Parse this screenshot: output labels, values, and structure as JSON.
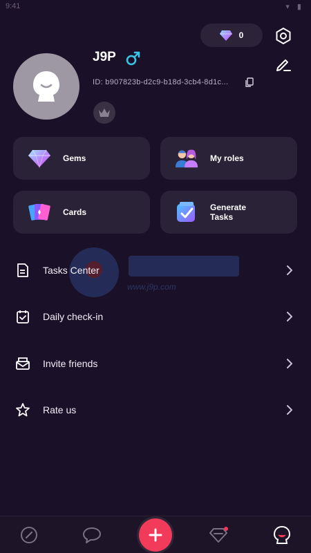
{
  "status_bar": {
    "time": "9:41",
    "icons": "▾ ▮"
  },
  "header": {
    "gem_balance": "0",
    "icons": {
      "gem": "gem-icon",
      "settings": "hexagon-settings-icon",
      "edit": "pencil-edit-icon"
    }
  },
  "profile": {
    "username": "J9P",
    "gender": "male",
    "user_id": "ID: b907823b-d2c9-b18d-3cb4-8d1c...",
    "avatar": "ghost-avatar",
    "badge": "crown-badge"
  },
  "cards": [
    {
      "label": "Gems",
      "icon": "gem-icon"
    },
    {
      "label": "My roles",
      "icon": "roles-icon"
    },
    {
      "label": "Cards",
      "icon": "cards-icon"
    },
    {
      "label": "Generate Tasks",
      "icon": "generate-tasks-icon"
    }
  ],
  "menu": [
    {
      "label": "Tasks Center",
      "icon": "tasks-icon"
    },
    {
      "label": "Daily check-in",
      "icon": "calendar-check-icon"
    },
    {
      "label": "Invite friends",
      "icon": "invite-mail-icon"
    },
    {
      "label": "Rate us",
      "icon": "star-icon"
    }
  ],
  "watermark": {
    "text": "www.j9p.com"
  },
  "bottom_nav": [
    {
      "name": "discover",
      "icon": "compass-icon"
    },
    {
      "name": "chat",
      "icon": "chat-bubble-icon"
    },
    {
      "name": "create",
      "icon": "plus-icon"
    },
    {
      "name": "gems",
      "icon": "gem-outline-icon",
      "badge": true
    },
    {
      "name": "profile",
      "icon": "ghost-avatar-icon",
      "active": true
    }
  ],
  "colors": {
    "background": "#1a1028",
    "card": "#2a2236",
    "accent": "#f23a5b",
    "gender": "#39c6e6"
  }
}
